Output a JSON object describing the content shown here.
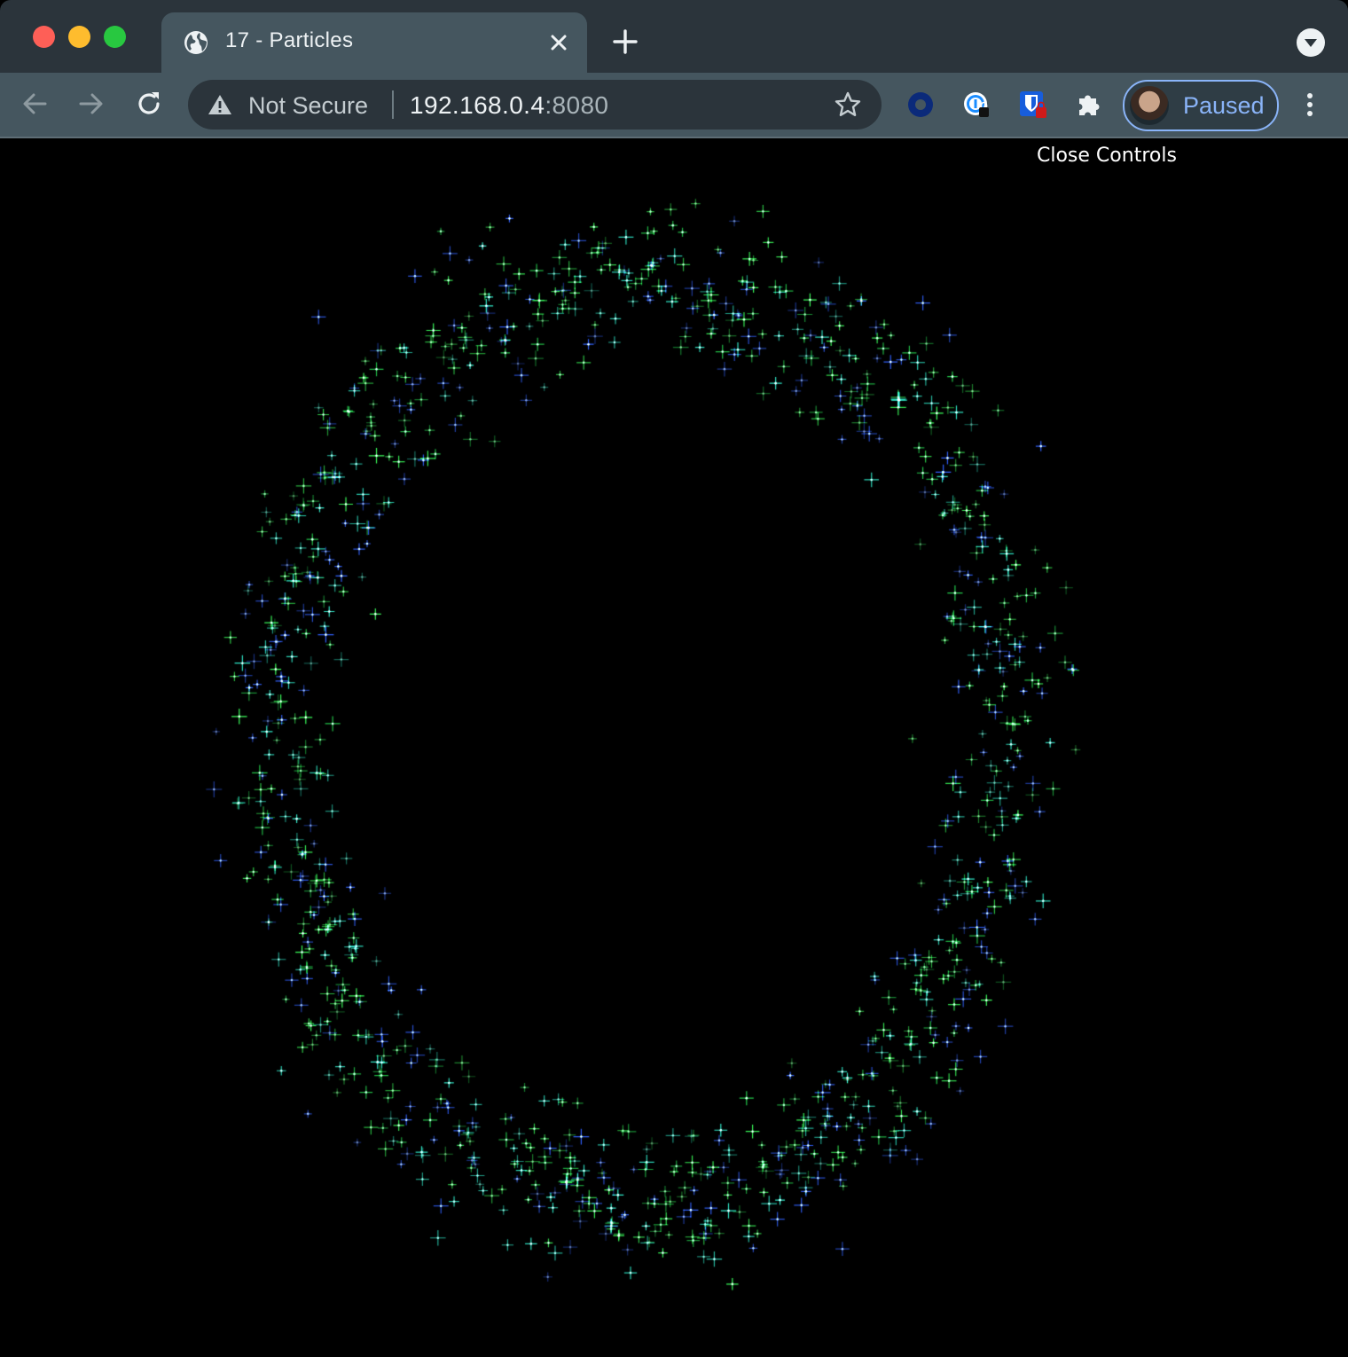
{
  "browser": {
    "tab": {
      "title": "17 - Particles",
      "favicon": "globe-icon"
    },
    "omnibox": {
      "security_label": "Not Secure",
      "url_host": "192.168.0.4",
      "url_port": ":8080"
    },
    "extensions": [
      "circle-extension-icon",
      "password-manager-icon",
      "bitwarden-icon",
      "puzzle-icon"
    ],
    "profile": {
      "label": "Paused"
    },
    "colors": {
      "frame": "#2b343b",
      "toolbar": "#45565f",
      "accent": "#8ab4f8"
    }
  },
  "page": {
    "controls_toggle": "Close Controls",
    "background": "#000000",
    "particle_colors": [
      "#39ff5a",
      "#2ee8c8",
      "#3060ff",
      "#22c84a"
    ]
  }
}
